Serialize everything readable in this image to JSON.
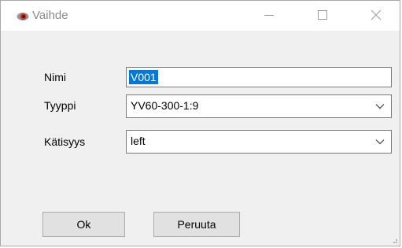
{
  "window": {
    "title": "Vaihde",
    "icon": "eye-icon",
    "controls": {
      "minimize": "minimize-icon",
      "maximize": "maximize-icon",
      "close": "close-icon"
    }
  },
  "form": {
    "nimi_label": "Nimi",
    "nimi_value": "V001",
    "tyyppi_label": "Tyyppi",
    "tyyppi_value": "YV60-300-1:9",
    "katisyys_label": "Kätisyys",
    "katisyys_value": "left"
  },
  "buttons": {
    "ok_label": "Ok",
    "cancel_label": "Peruuta"
  },
  "colors": {
    "selection": "#0078d7",
    "client_bg": "#f0f0f0",
    "icon_accent": "#c0392b"
  }
}
